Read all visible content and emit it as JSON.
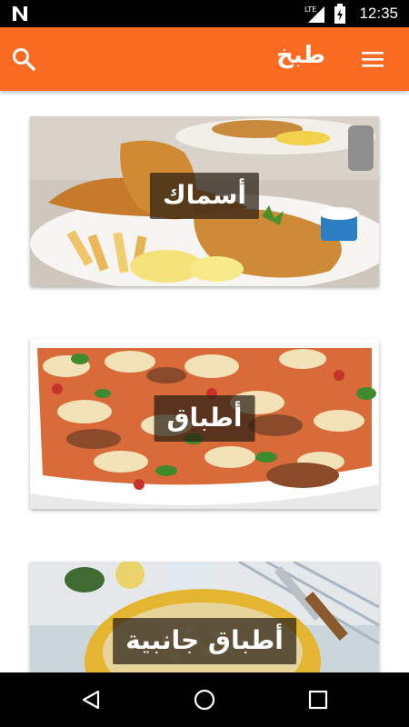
{
  "status_bar": {
    "time": "12:35",
    "network": "LTE",
    "icons": [
      "android-n-icon",
      "signal-icon",
      "battery-icon"
    ]
  },
  "app_bar": {
    "title": "طبخ",
    "icons": [
      "search-icon",
      "hamburger-menu-icon"
    ],
    "color": "#fb6a21"
  },
  "categories": [
    {
      "label": "أسماك"
    },
    {
      "label": "أطباق"
    },
    {
      "label": "أطباق جانبية"
    }
  ],
  "nav_bar": {
    "icons": [
      "back-icon",
      "home-icon",
      "recents-icon"
    ]
  }
}
